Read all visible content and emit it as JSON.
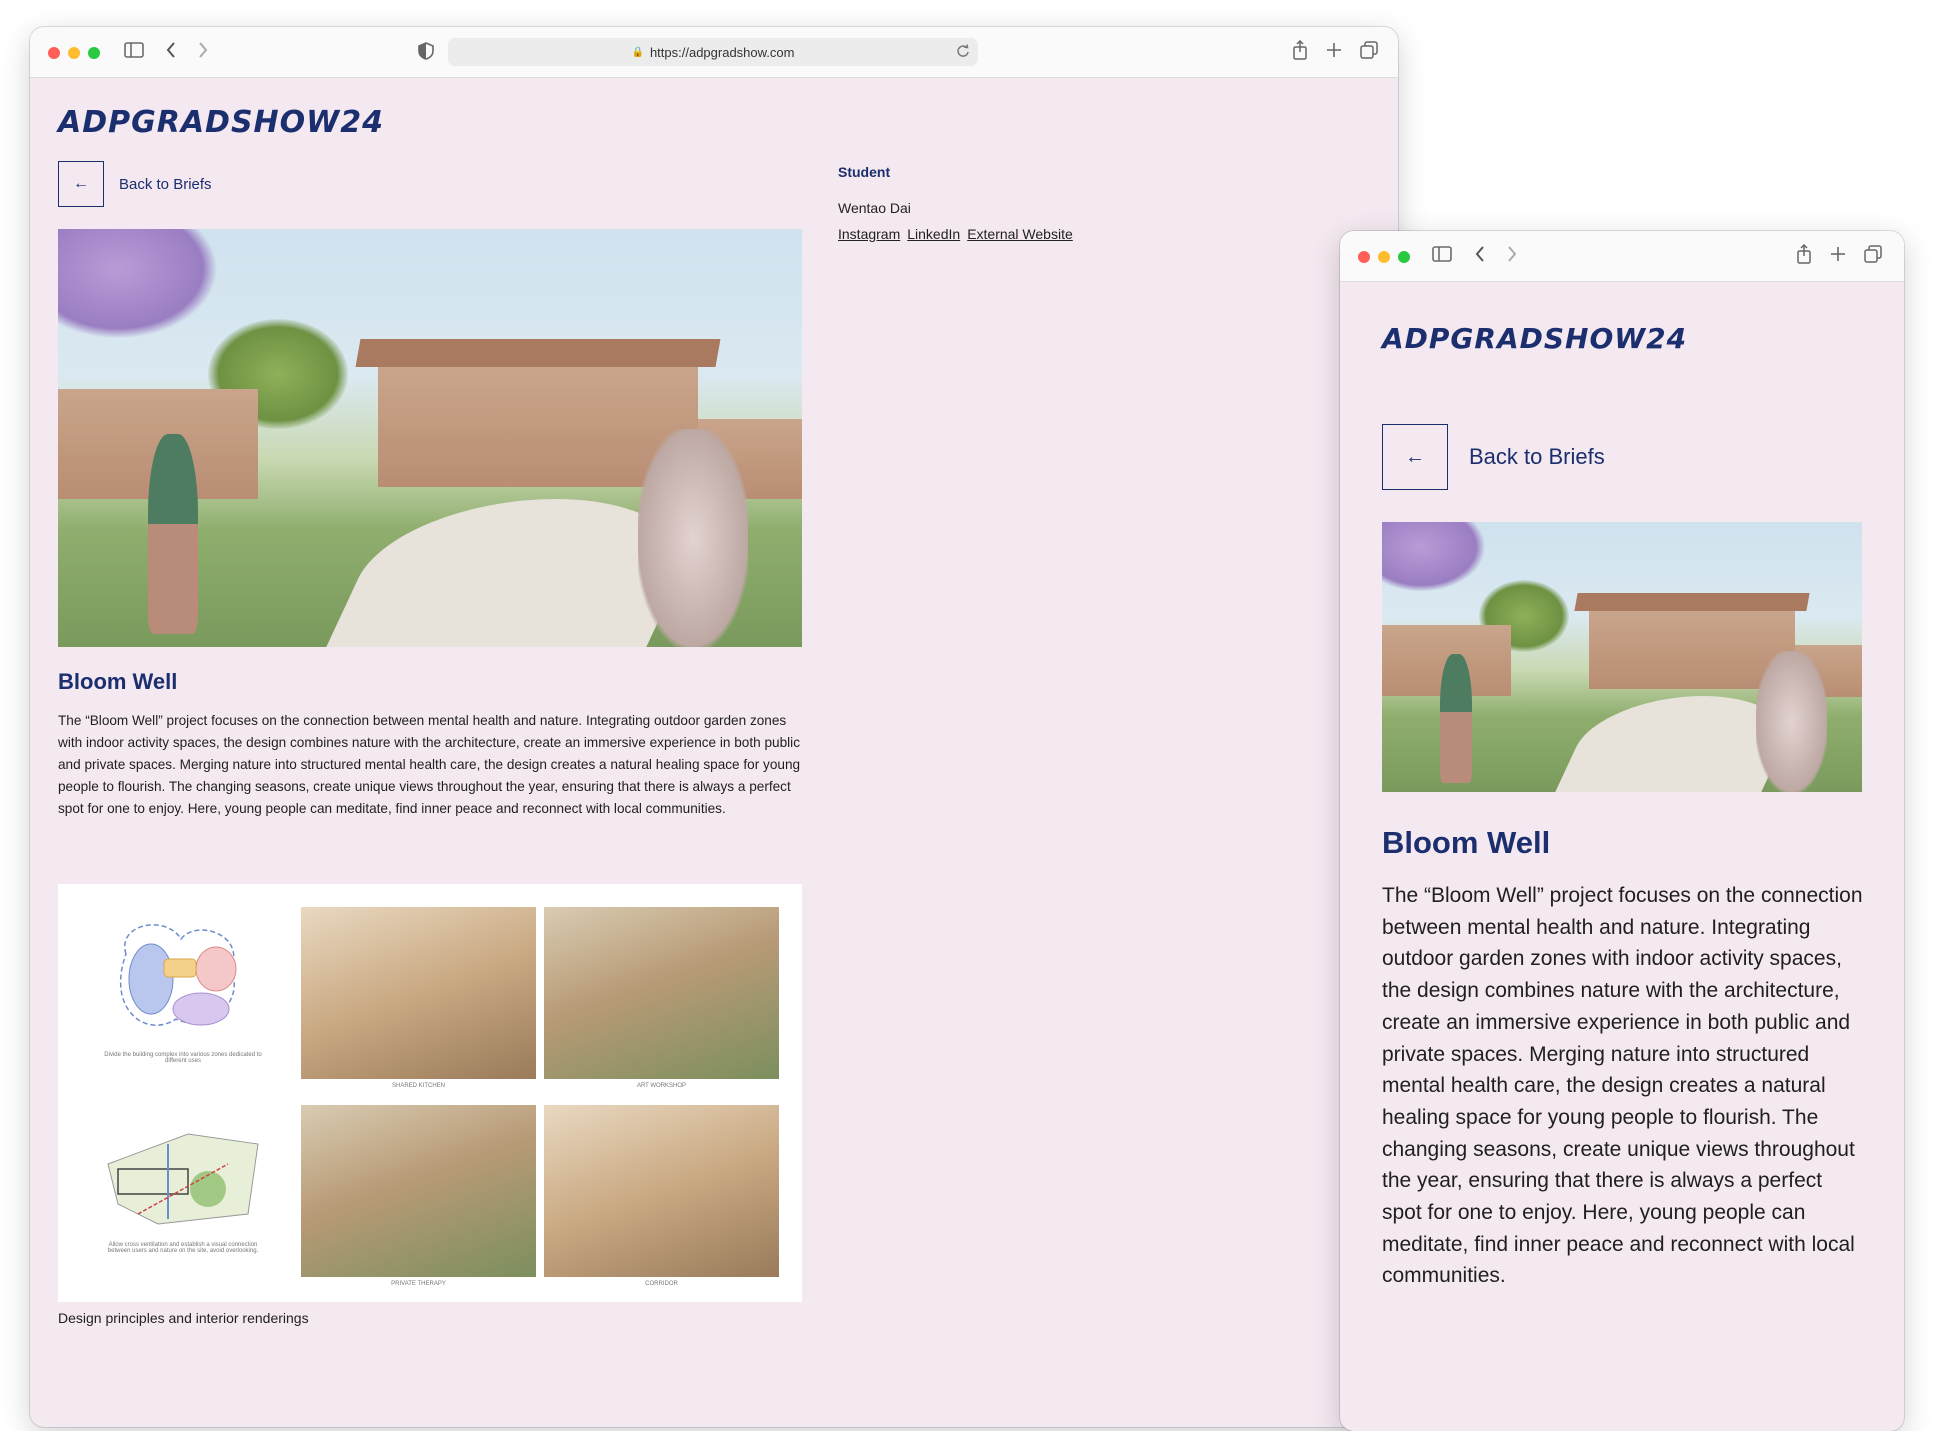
{
  "browser": {
    "url": "https://adpgradshow.com",
    "traffic_light_colors": [
      "#ff5f57",
      "#febc2e",
      "#28c840"
    ]
  },
  "site": {
    "logo": "ADPGRADSHOW24",
    "back_label": "Back to Briefs",
    "back_arrow": "←"
  },
  "project": {
    "title": "Bloom Well",
    "description": "The “Bloom Well” project focuses on the connection between mental health and nature. Integrating outdoor garden zones with indoor activity spaces, the design combines nature with the architecture, create an immersive experience in both public and private spaces. Merging nature into structured mental health care, the design creates a natural healing space for young people to flourish. The changing seasons, create unique views throughout the year, ensuring that there is always a perfect spot for one to enjoy. Here, young people can meditate, find inner peace and reconnect with local communities.",
    "gallery_caption": "Design principles and interior renderings",
    "collage_captions": {
      "diagram1": "Divide the building complex into various zones dedicated to different uses",
      "kitchen": "SHARED KITCHEN",
      "workshop": "ART WORKSHOP",
      "diagram2": "Allow cross ventilation and establish a visual connection between users and nature on the site, avoid overlooking.",
      "therapy": "PRIVATE THERAPY",
      "corridor": "CORRIDOR"
    }
  },
  "student": {
    "label": "Student",
    "name": "Wentao Dai",
    "links": [
      "Instagram",
      "LinkedIn",
      "External Website"
    ]
  },
  "colors": {
    "page_bg": "#f4e8f1",
    "accent": "#1b2e6e"
  }
}
